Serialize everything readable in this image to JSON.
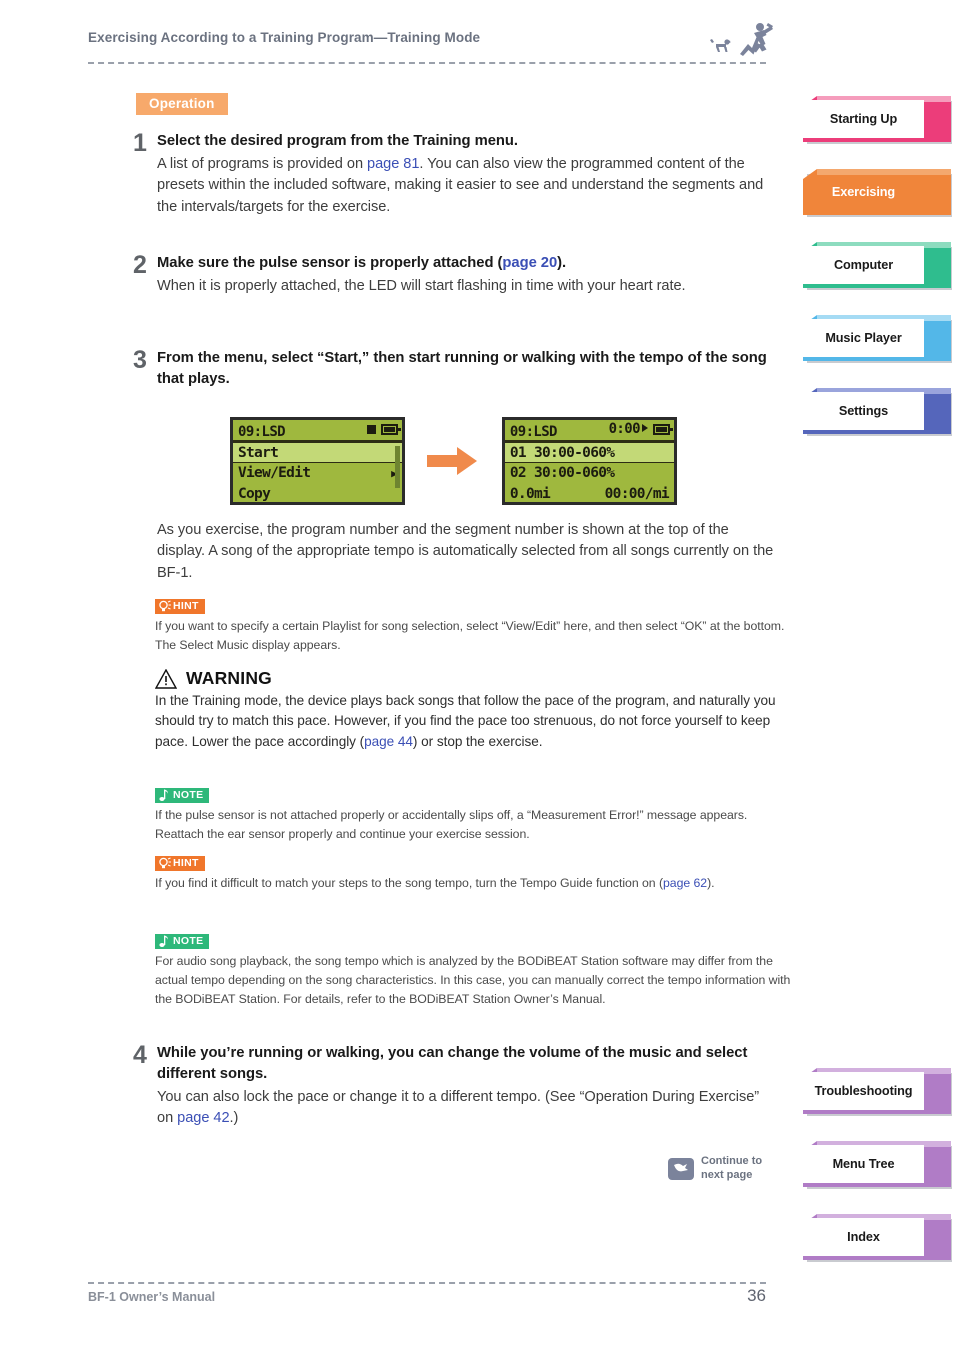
{
  "header": {
    "title": "Exercising According to a Training Program—Training Mode",
    "icon": "running-person-dog-icon"
  },
  "operation_badge": "Operation",
  "steps": [
    {
      "num": "1",
      "title": "Select the desired program from the Training menu.",
      "text_parts": [
        {
          "t": "A list of programs is provided on ",
          "link": false
        },
        {
          "t": "page 81",
          "link": true
        },
        {
          "t": ". You can also view the programmed content of the presets within the included software, making it easier to see and understand the segments and the intervals/targets for the exercise.",
          "link": false
        }
      ]
    },
    {
      "num": "2",
      "title_parts": [
        {
          "t": "Make sure the pulse sensor is properly attached (",
          "link": false
        },
        {
          "t": "page 20",
          "link": true
        },
        {
          "t": ").",
          "link": false
        }
      ],
      "text_parts": [
        {
          "t": "When it is properly attached, the LED will start flashing in time with your heart rate.",
          "link": false
        }
      ]
    },
    {
      "num": "3",
      "title": "From the menu, select “Start,” then start running or walking with the tempo of the song that plays.",
      "text_parts": [
        {
          "t": "As you exercise, the program number and the segment number is shown at the top of the display. A song of the appropriate tempo is automatically selected from all songs currently on the BF-1.",
          "link": false
        }
      ]
    },
    {
      "num": "4",
      "title": "While you’re running or walking, you can change the volume of the music and select different songs.",
      "text_parts": [
        {
          "t": "You can also lock the pace or change it to a different tempo. (See “Operation During Exercise” on ",
          "link": false
        },
        {
          "t": "page 42",
          "link": true
        },
        {
          "t": ".)",
          "link": false
        }
      ]
    }
  ],
  "lcd_screens": {
    "left": {
      "title": "09:LSD",
      "status_square": "stop-square-icon",
      "battery": "battery-icon",
      "rows": [
        {
          "label": "Start",
          "selected": true,
          "chevron": ""
        },
        {
          "label": "View/Edit",
          "selected": false,
          "chevron": "▶"
        },
        {
          "label": "Copy",
          "selected": false,
          "chevron": ""
        }
      ]
    },
    "arrow": "right-arrow-icon",
    "right": {
      "title": "09:LSD",
      "time": "0:00",
      "play": "play-icon",
      "battery": "battery-icon",
      "rows": [
        {
          "label": "01 30:00-060%",
          "right": "",
          "selected": true
        },
        {
          "label": "02 30:00-060%",
          "right": "",
          "selected": false
        },
        {
          "label": "0.0mi",
          "right": "00:00/mi",
          "selected": false
        }
      ]
    }
  },
  "callouts": [
    {
      "type": "hint",
      "tag": "HINT",
      "icon": "lightbulb-icon",
      "text": "If you want to specify a certain Playlist for song selection, select “View/Edit” here, and then select “OK” at the bottom. The Select Music display appears."
    },
    {
      "type": "note",
      "tag": "NOTE",
      "icon": "music-note-icon",
      "text": "If the pulse sensor is not attached properly or accidentally slips off, a “Measurement Error!” message appears. Reattach the ear sensor properly and continue your exercise session."
    },
    {
      "type": "hint",
      "tag": "HINT",
      "icon": "lightbulb-icon",
      "text_parts": [
        {
          "t": "If you find it difficult to match your steps to the song tempo, turn the Tempo Guide function on (",
          "link": false
        },
        {
          "t": "page 62",
          "link": true
        },
        {
          "t": ").",
          "link": false
        }
      ]
    },
    {
      "type": "note",
      "tag": "NOTE",
      "icon": "music-note-icon",
      "text": "For audio song playback, the song tempo which is analyzed by the BODiBEAT Station software may differ from the actual tempo depending on the song characteristics. In this case, you can manually correct the tempo information with the BODiBEAT Station. For details, refer to the BODiBEAT Station Owner’s Manual."
    }
  ],
  "warning": {
    "icon": "warning-triangle-icon",
    "heading": "WARNING",
    "text_parts": [
      {
        "t": "In the Training mode, the device plays back songs that follow the pace of the program, and naturally you should try to match this pace. However, if you find the pace too strenuous, do not force yourself to keep pace. Lower the pace accordingly (",
        "link": false
      },
      {
        "t": "page 44",
        "link": true
      },
      {
        "t": ") or stop the exercise.",
        "link": false
      }
    ]
  },
  "continue_notice": {
    "icon": "continue-arrow-icon",
    "line1": "Continue to",
    "line2": "next page"
  },
  "footer": {
    "manual": "BF-1 Owner’s Manual",
    "page_number": "36"
  },
  "sidebar": {
    "top_tabs": [
      {
        "label": "Starting Up",
        "color": "#ec3d7a",
        "light": "#f59cbc",
        "active": false
      },
      {
        "label": "Exercising",
        "color": "#f0853a",
        "light": "#f4a86e",
        "active": true
      },
      {
        "label": "Computer",
        "color": "#2fbd8e",
        "light": "#8ddcbf",
        "active": false
      },
      {
        "label": "Music Player",
        "color": "#53b7e8",
        "light": "#a5dbf4",
        "active": false
      },
      {
        "label": "Settings",
        "color": "#5566bb",
        "light": "#9aa4dc",
        "active": false
      }
    ],
    "bottom_tabs": [
      {
        "label": "Troubleshooting",
        "color": "#b07cc6",
        "light": "#d2b0de",
        "active": false
      },
      {
        "label": "Menu Tree",
        "color": "#b07cc6",
        "light": "#d2b0de",
        "active": false
      },
      {
        "label": "Index",
        "color": "#b07cc6",
        "light": "#d2b0de",
        "active": false
      }
    ]
  }
}
